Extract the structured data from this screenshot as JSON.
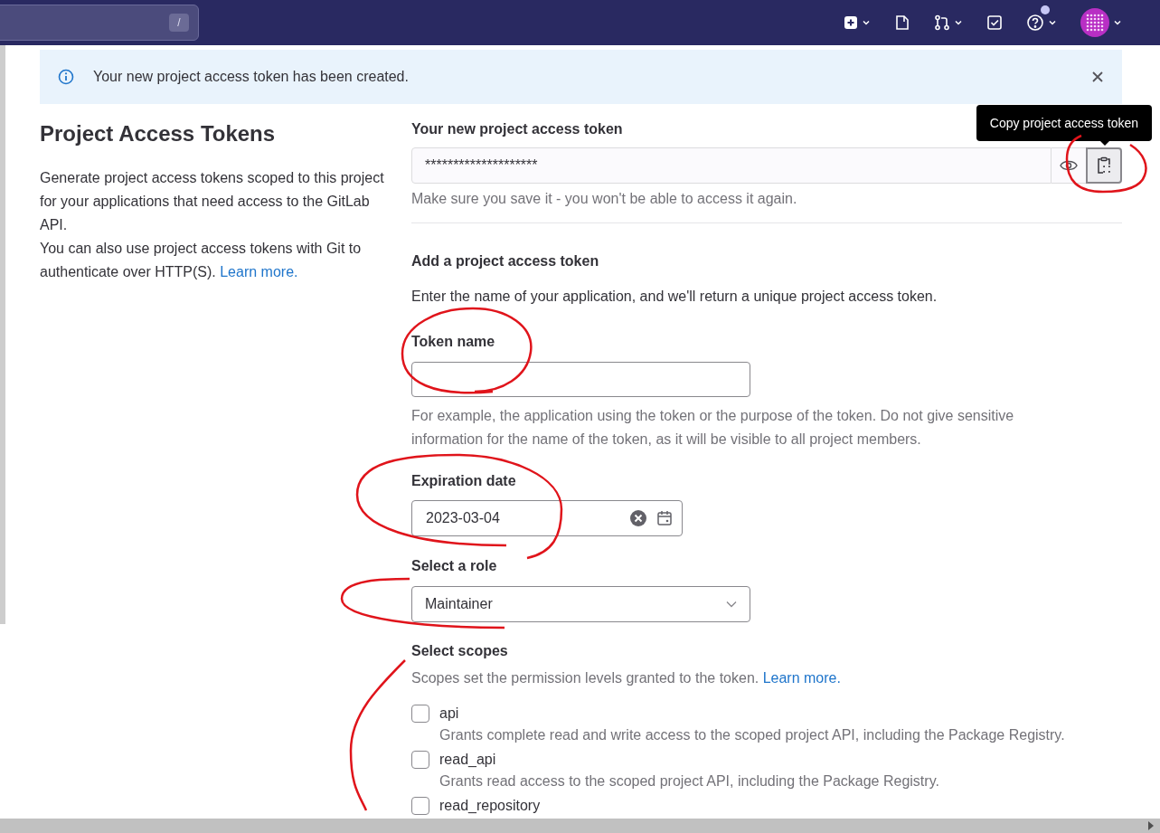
{
  "navbar": {
    "search_key": "/"
  },
  "alert": {
    "text": "Your new project access token has been created."
  },
  "intro": {
    "title": "Project Access Tokens",
    "paragraphs": [
      "Generate project access tokens scoped to this project for your applications that need access to the GitLab API."
    ],
    "last_paragraph": "You can also use project access tokens with Git to authenticate over HTTP(S).",
    "link": "Learn more."
  },
  "new_token": {
    "label": "Your new project access token",
    "value": "********************",
    "hint": "Make sure you save it - you won't be able to access it again.",
    "tooltip": "Copy project access token"
  },
  "form": {
    "title": "Add a project access token",
    "description": "Enter the name of your application, and we'll return a unique project access token.",
    "token_name": {
      "label": "Token name",
      "help": "For example, the application using the token or the purpose of the token. Do not give sensitive information for the name of the token, as it will be visible to all project members."
    },
    "expiration": {
      "label": "Expiration date",
      "value": "2023-03-04"
    },
    "role": {
      "label": "Select a role",
      "value": "Maintainer"
    },
    "scopes": {
      "label": "Select scopes",
      "description": "Scopes set the permission levels granted to the token.",
      "link": "Learn more.",
      "items": [
        {
          "name": "api",
          "description": "Grants complete read and write access to the scoped project API, including the Package Registry.",
          "checked": false
        },
        {
          "name": "read_api",
          "description": "Grants read access to the scoped project API, including the Package Registry.",
          "checked": false
        },
        {
          "name": "read_repository",
          "checked": false
        }
      ]
    }
  }
}
